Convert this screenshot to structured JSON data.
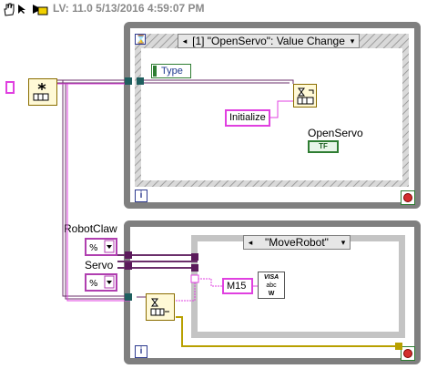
{
  "toolbar": {
    "version_text": "LV: 11.0 5/13/2016 4:59:07 PM"
  },
  "icons": [
    "hand-tool-icon",
    "arrow-icon",
    "run-continuous-icon",
    "abort-icon"
  ],
  "event_loop": {
    "event_selector": "[1] \"OpenServo\": Value Change",
    "event_data_label": "Type",
    "initialize_constant": "Initialize",
    "openservo_label": "OpenServo",
    "openservo_value": "TF",
    "iteration_label": "i"
  },
  "robot_loop": {
    "robotclaw_label": "RobotClaw",
    "servo_label": "Servo",
    "case_selector": "\"MoveRobot\"",
    "m15_constant": "M15",
    "visa_label": "VISA",
    "visa_sub": "abc",
    "visa_bottom": "W",
    "iteration_label": "i"
  },
  "colors": {
    "loop_border": "#7f7f7f",
    "string_wire": "#e040e0",
    "queue_wire": "#6b2f6b",
    "error_wire": "#b8a000",
    "boolean": "#2e7d32",
    "iteration": "#2d3a8f"
  }
}
